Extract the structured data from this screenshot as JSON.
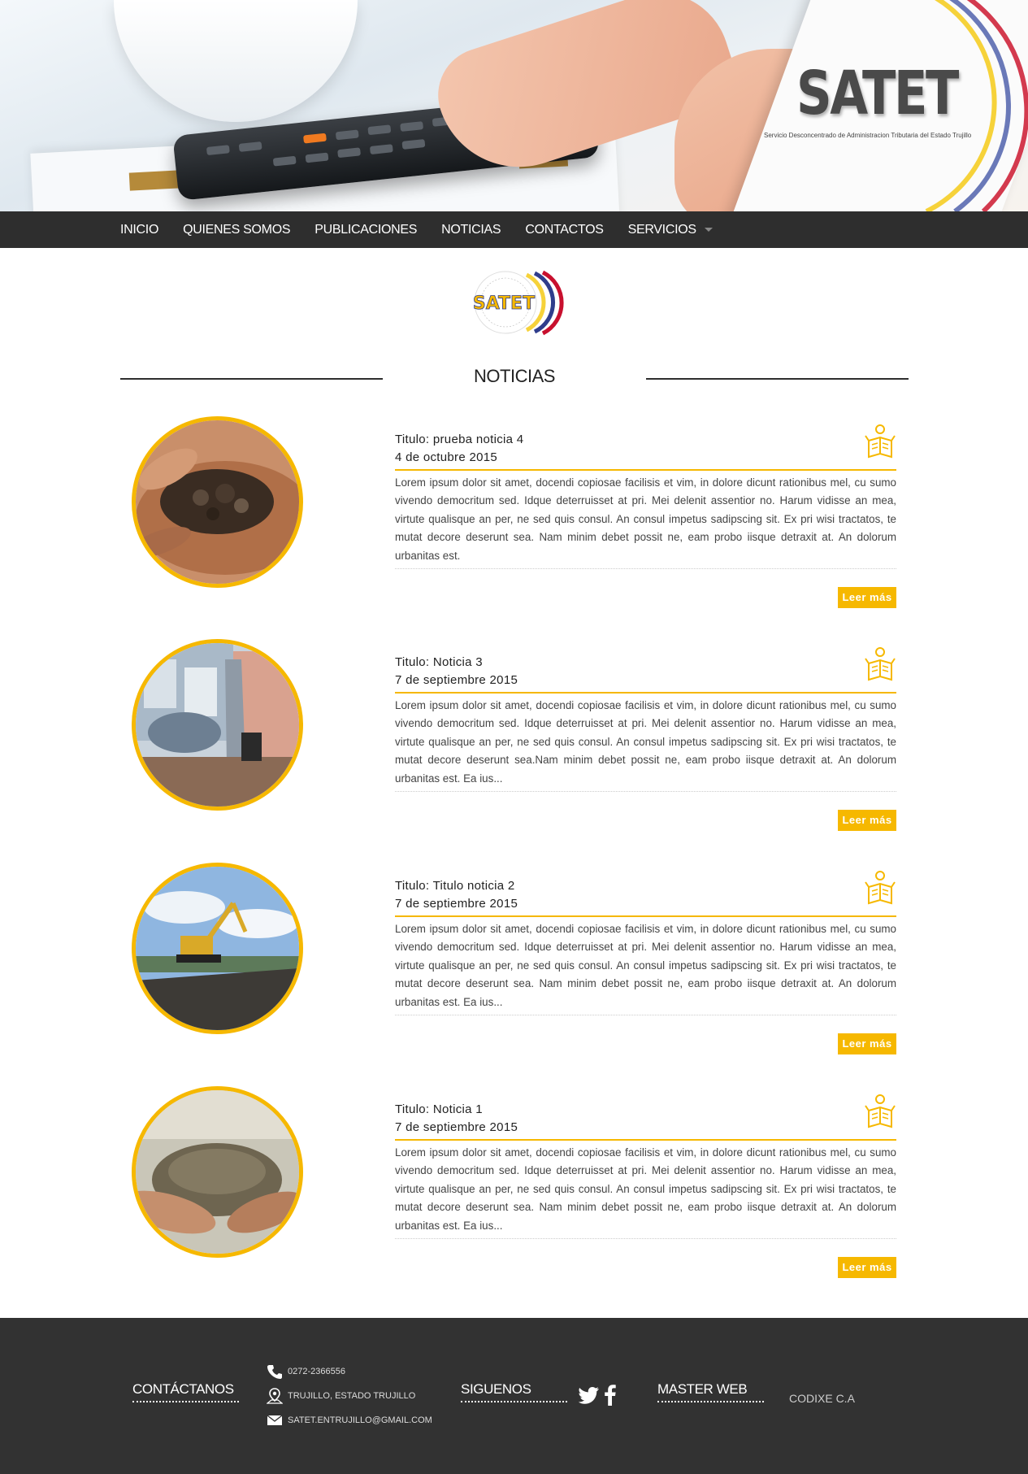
{
  "header": {
    "brand": "SATET",
    "brand_subtitle": "Servicio Desconcentrado de Administracion Tributaria del Estado Trujillo"
  },
  "nav": {
    "items": [
      "INICIO",
      "QUIENES SOMOS",
      "PUBLICACIONES",
      "NOTICIAS",
      "CONTACTOS",
      "SERVICIOS"
    ]
  },
  "center_logo": {
    "text": "SATET"
  },
  "section_title": "NOTICIAS",
  "news": [
    {
      "title": "Titulo: prueba noticia 4",
      "date": "4 de octubre 2015",
      "text": "Lorem ipsum dolor sit amet, docendi copiosae facilisis et vim, in dolore dicunt rationibus mel, cu sumo vivendo democritum sed. Idque deterruisset at pri. Mei delenit assentior no. Harum vidisse an mea, virtute qualisque an per, ne sed quis consul. An consul impetus sadipscing sit. Ex pri wisi tractatos, te mutat decore deserunt sea. Nam minim debet possit ne, eam probo iisque detraxit at. An dolorum urbanitas est.",
      "more": "Leer más"
    },
    {
      "title": "Titulo: Noticia 3",
      "date": "7 de septiembre 2015",
      "text": "Lorem ipsum dolor sit amet, docendi copiosae facilisis et vim, in dolore dicunt rationibus mel, cu sumo vivendo democritum sed. Idque deterruisset at pri. Mei delenit assentior no. Harum vidisse an mea, virtute qualisque an per, ne sed quis consul. An consul impetus sadipscing sit. Ex pri wisi tractatos, te mutat decore deserunt sea.Nam minim debet possit ne, eam probo iisque detraxit at. An dolorum urbanitas est. Ea ius...",
      "more": "Leer más"
    },
    {
      "title": "Titulo: Titulo noticia 2",
      "date": "7 de septiembre 2015",
      "text": "Lorem ipsum dolor sit amet, docendi copiosae facilisis et vim, in dolore dicunt rationibus mel, cu sumo vivendo democritum sed. Idque deterruisset at pri. Mei delenit assentior no. Harum vidisse an mea, virtute qualisque an per, ne sed quis consul. An consul impetus sadipscing sit. Ex pri wisi tractatos, te mutat decore deserunt sea. Nam minim debet possit ne, eam probo iisque detraxit at. An dolorum urbanitas est. Ea ius...",
      "more": "Leer más"
    },
    {
      "title": "Titulo: Noticia 1",
      "date": "7 de septiembre 2015",
      "text": "Lorem ipsum dolor sit amet, docendi copiosae facilisis et vim, in dolore dicunt rationibus mel, cu sumo vivendo democritum sed. Idque deterruisset at pri. Mei delenit assentior no. Harum vidisse an mea, virtute qualisque an per, ne sed quis consul. An consul impetus sadipscing sit. Ex pri wisi tractatos, te mutat decore deserunt sea. Nam minim debet possit ne, eam probo iisque detraxit at. An dolorum urbanitas est. Ea ius...",
      "more": "Leer más"
    }
  ],
  "footer": {
    "contact_title": "CONTÁCTANOS",
    "phone": "0272-2366556",
    "address": "TRUJILLO, ESTADO TRUJILLO",
    "email": "SATET.ENTRUJILLO@GMAIL.COM",
    "follow_title": "SIGUENOS",
    "master_title": "MASTER WEB",
    "master_value": "CODIXE C.A"
  },
  "colors": {
    "accent": "#f6b800",
    "nav_bg": "#2e2e2e",
    "footer_bg": "#323232"
  },
  "icons": [
    "phone-icon",
    "location-icon",
    "mail-icon",
    "twitter-icon",
    "facebook-icon",
    "reader-icon",
    "chevron-down-icon"
  ]
}
